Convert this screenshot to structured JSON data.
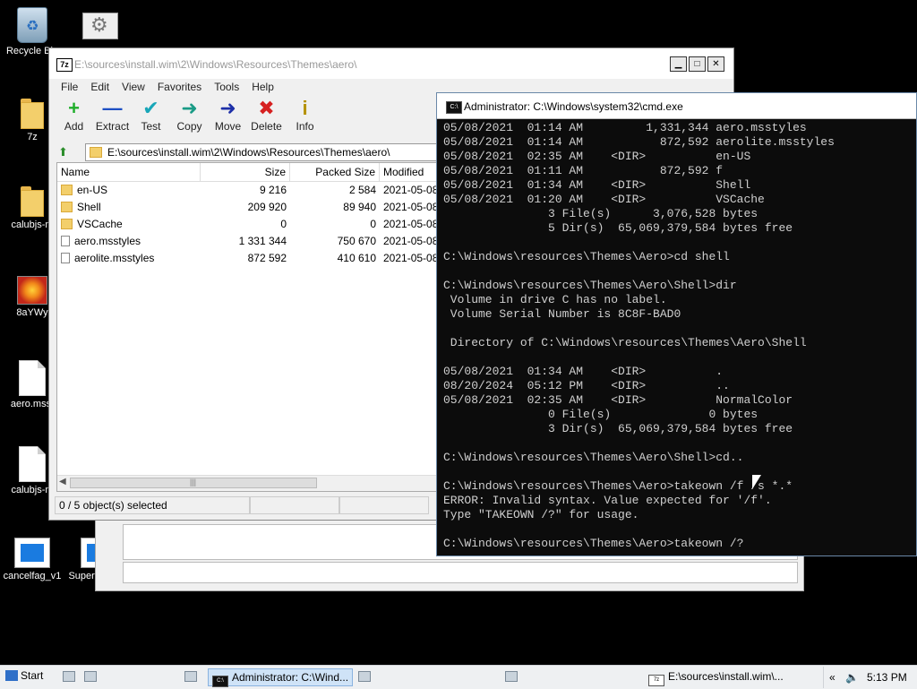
{
  "desktop": {
    "icons": [
      {
        "label": "Recycle Bin",
        "icon": "recycle-bin-icon"
      },
      {
        "label": "",
        "icon": "settings-icon"
      },
      {
        "label": "7z",
        "icon": "folder-icon"
      },
      {
        "label": "calubjs-m",
        "icon": "folder-icon"
      },
      {
        "label": "8aYWy",
        "icon": "image-icon"
      },
      {
        "label": "aero.msst",
        "icon": "file-icon"
      },
      {
        "label": "calubjs-m",
        "icon": "file-icon"
      },
      {
        "label": "cancelfag_v1",
        "icon": "app-icon"
      },
      {
        "label": "Supermiu",
        "icon": "app-icon"
      }
    ]
  },
  "zip": {
    "title": "E:\\sources\\install.wim\\2\\Windows\\Resources\\Themes\\aero\\",
    "app_icon_text": "7z",
    "menu": [
      "File",
      "Edit",
      "View",
      "Favorites",
      "Tools",
      "Help"
    ],
    "toolbar": [
      {
        "label": "Add",
        "glyph": "+",
        "color": "#1fae2a",
        "icon": "add-icon"
      },
      {
        "label": "Extract",
        "glyph": "—",
        "color": "#1d4fc4",
        "icon": "extract-icon"
      },
      {
        "label": "Test",
        "glyph": "✔",
        "color": "#18a6b8",
        "icon": "test-icon"
      },
      {
        "label": "Copy",
        "glyph": "➜",
        "color": "#1a9b86",
        "icon": "copy-icon"
      },
      {
        "label": "Move",
        "glyph": "➜",
        "color": "#1d2fa8",
        "icon": "move-icon"
      },
      {
        "label": "Delete",
        "glyph": "✖",
        "color": "#d62020",
        "icon": "delete-icon"
      },
      {
        "label": "Info",
        "glyph": "i",
        "color": "#b59200",
        "icon": "info-icon"
      }
    ],
    "address": "E:\\sources\\install.wim\\2\\Windows\\Resources\\Themes\\aero\\",
    "columns": {
      "name": "Name",
      "size": "Size",
      "packed": "Packed Size",
      "modified": "Modified"
    },
    "rows": [
      {
        "name": "en-US",
        "size": "9 216",
        "packed": "2 584",
        "modified": "2021-05-08",
        "type": "folder"
      },
      {
        "name": "Shell",
        "size": "209 920",
        "packed": "89 940",
        "modified": "2021-05-08",
        "type": "folder"
      },
      {
        "name": "VSCache",
        "size": "0",
        "packed": "0",
        "modified": "2021-05-08",
        "type": "folder"
      },
      {
        "name": "aero.msstyles",
        "size": "1 331 344",
        "packed": "750 670",
        "modified": "2021-05-08",
        "type": "file"
      },
      {
        "name": "aerolite.msstyles",
        "size": "872 592",
        "packed": "410 610",
        "modified": "2021-05-08",
        "type": "file"
      }
    ],
    "status": "0 / 5 object(s) selected"
  },
  "cmd": {
    "title": "Administrator: C:\\Windows\\system32\\cmd.exe",
    "lines": [
      "05/08/2021  01:14 AM         1,331,344 aero.msstyles",
      "05/08/2021  01:14 AM           872,592 aerolite.msstyles",
      "05/08/2021  02:35 AM    <DIR>          en-US",
      "05/08/2021  01:11 AM           872,592 f",
      "05/08/2021  01:34 AM    <DIR>          Shell",
      "05/08/2021  01:20 AM    <DIR>          VSCache",
      "               3 File(s)      3,076,528 bytes",
      "               5 Dir(s)  65,069,379,584 bytes free",
      "",
      "C:\\Windows\\resources\\Themes\\Aero>cd shell",
      "",
      "C:\\Windows\\resources\\Themes\\Aero\\Shell>dir",
      " Volume in drive C has no label.",
      " Volume Serial Number is 8C8F-BAD0",
      "",
      " Directory of C:\\Windows\\resources\\Themes\\Aero\\Shell",
      "",
      "05/08/2021  01:34 AM    <DIR>          .",
      "08/20/2024  05:12 PM    <DIR>          ..",
      "05/08/2021  02:35 AM    <DIR>          NormalColor",
      "               0 File(s)              0 bytes",
      "               3 Dir(s)  65,069,379,584 bytes free",
      "",
      "C:\\Windows\\resources\\Themes\\Aero\\Shell>cd..",
      "",
      "C:\\Windows\\resources\\Themes\\Aero>takeown /f /s *.*",
      "ERROR: Invalid syntax. Value expected for '/f'.",
      "Type \"TAKEOWN /?\" for usage.",
      "",
      "C:\\Windows\\resources\\Themes\\Aero>takeown /?"
    ]
  },
  "taskbar": {
    "start_label": "Start",
    "buttons": [
      {
        "label": "Administrator: C:\\Wind...",
        "active": true,
        "icon_text": "C:\\"
      },
      {
        "label": "E:\\sources\\install.wim\\...",
        "active": false,
        "icon_text": "7z"
      }
    ],
    "clock": "5:13 PM",
    "tray_chevron": "«"
  },
  "colors": {
    "desktop_bg": "#000000",
    "cmd_bg": "#0c0c0c",
    "cmd_text": "#cfcfcf"
  }
}
